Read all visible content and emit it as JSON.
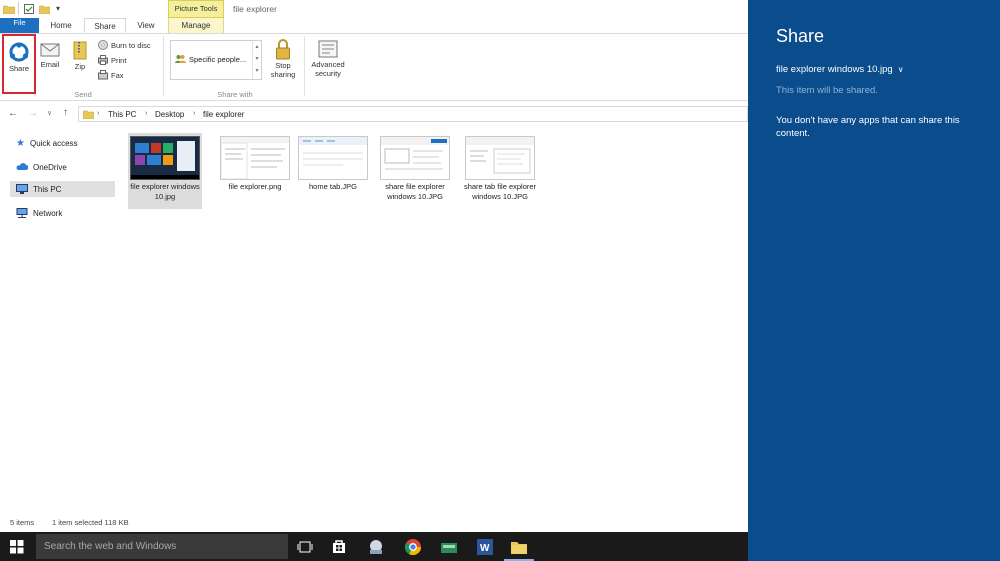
{
  "window": {
    "title": "file explorer",
    "picture_tools": "Picture Tools"
  },
  "tabs": [
    {
      "label": "File"
    },
    {
      "label": "Home"
    },
    {
      "label": "Share"
    },
    {
      "label": "View"
    },
    {
      "label": "Manage"
    }
  ],
  "ribbon": {
    "share": "Share",
    "email": "Email",
    "zip": "Zip",
    "burn": "Burn to disc",
    "print": "Print",
    "fax": "Fax",
    "send_group": "Send",
    "specific_people": "Specific people...",
    "share_with_group": "Share with",
    "stop_sharing": "Stop sharing",
    "advanced_security": "Advanced security"
  },
  "address": {
    "crumbs": [
      "This PC",
      "Desktop",
      "file explorer"
    ]
  },
  "nav": [
    {
      "label": "Quick access"
    },
    {
      "label": "OneDrive"
    },
    {
      "label": "This PC"
    },
    {
      "label": "Network"
    }
  ],
  "files": [
    {
      "name": "file explorer windows 10.jpg"
    },
    {
      "name": "file explorer.png"
    },
    {
      "name": "home tab.JPG"
    },
    {
      "name": "share file explorer windows 10.JPG"
    },
    {
      "name": "share tab file explorer windows 10.JPG"
    }
  ],
  "status": {
    "count": "5 items",
    "selection": "1 item selected  118 KB"
  },
  "taskbar": {
    "search_placeholder": "Search the web and Windows"
  },
  "share_pane": {
    "title": "Share",
    "file": "file explorer windows 10.jpg",
    "subtitle": "This item will be shared.",
    "message": "You don't have any apps that can share this content."
  },
  "colors": {
    "accent": "#1e6fbf",
    "share_pane": "#0a4c8c",
    "taskbar": "#1a1a1a",
    "highlight": "#d9262b"
  }
}
